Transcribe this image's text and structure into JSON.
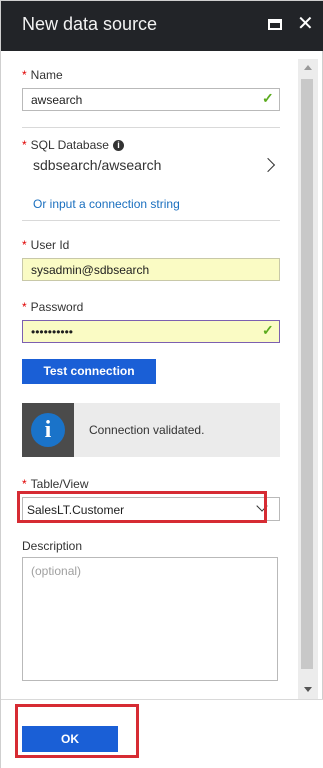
{
  "blade": {
    "title": "New data source"
  },
  "form": {
    "name": {
      "label": "Name",
      "value": "awsearch"
    },
    "sql_database": {
      "label": "SQL Database",
      "value": "sdbsearch/awsearch",
      "link": "Or input a connection string"
    },
    "user_id": {
      "label": "User Id",
      "value": "sysadmin@sdbsearch"
    },
    "password": {
      "label": "Password",
      "masked_value": "••••••••••"
    },
    "test_button": "Test connection",
    "status_message": "Connection validated.",
    "table_view": {
      "label": "Table/View",
      "value": "SalesLT.Customer"
    },
    "description": {
      "label": "Description",
      "placeholder": "(optional)"
    }
  },
  "footer": {
    "ok_label": "OK"
  },
  "colors": {
    "titlebar": "#222428",
    "primary_button": "#1a5fd6",
    "highlight_box": "#d62b33",
    "valid_check": "#5bab1e",
    "link": "#1a6fbf",
    "autofill_yellow": "#fafbc4"
  },
  "icons": {
    "maximize": "maximize-icon",
    "close": "close-icon",
    "info": "info-icon",
    "chevron": "chevron-right-icon",
    "check": "checkmark-icon"
  }
}
